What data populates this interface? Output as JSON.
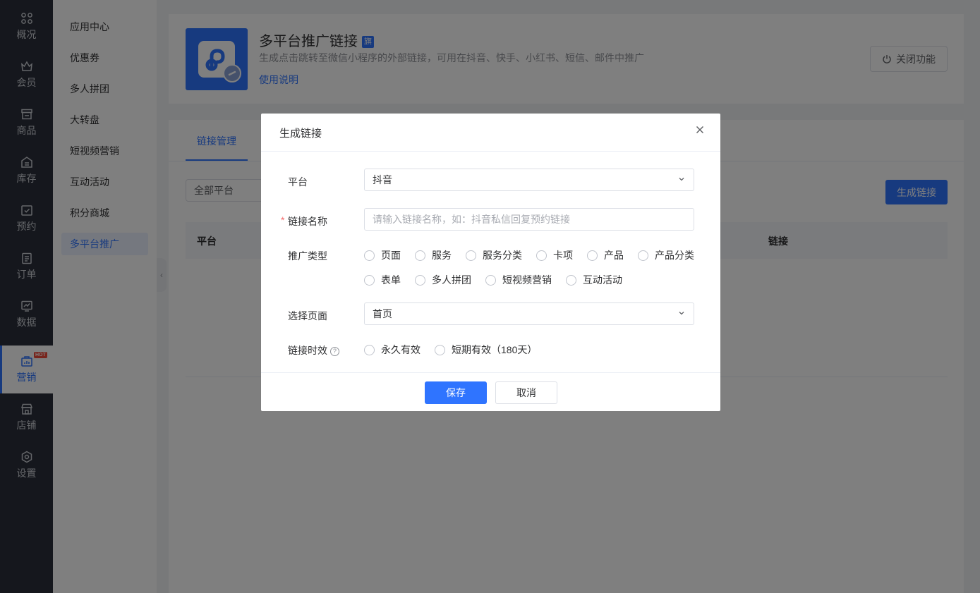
{
  "nav": {
    "items": [
      {
        "label": "概况",
        "icon": "grid-icon"
      },
      {
        "label": "会员",
        "icon": "crown-icon"
      },
      {
        "label": "商品",
        "icon": "shop-icon"
      },
      {
        "label": "库存",
        "icon": "warehouse-icon"
      },
      {
        "label": "预约",
        "icon": "calendar-check-icon"
      },
      {
        "label": "订单",
        "icon": "order-icon"
      },
      {
        "label": "数据",
        "icon": "chart-icon"
      },
      {
        "label": "营销",
        "icon": "marketing-icon",
        "badge": "HOT"
      },
      {
        "label": "店铺",
        "icon": "store-icon"
      },
      {
        "label": "设置",
        "icon": "settings-icon"
      }
    ]
  },
  "submenu": {
    "items": [
      "应用中心",
      "优惠券",
      "多人拼团",
      "大转盘",
      "短视频营销",
      "互动活动",
      "积分商城",
      "多平台推广"
    ]
  },
  "app": {
    "title": "多平台推广链接",
    "flag": "旗",
    "description": "生成点击跳转至微信小程序的外部链接，可用在抖音、快手、小红书、短信、邮件中推广",
    "help_link": "使用说明",
    "close_button": "关闭功能"
  },
  "tabs": {
    "active": "链接管理"
  },
  "filter": {
    "platform": "全部平台"
  },
  "toolbar": {
    "generate": "生成链接"
  },
  "table": {
    "headers": {
      "platform": "平台",
      "link": "链接"
    }
  },
  "dialog": {
    "title": "生成链接",
    "platform_label": "平台",
    "platform_value": "抖音",
    "name_label": "链接名称",
    "name_placeholder": "请输入链接名称，如：抖音私信回复预约链接",
    "type_label": "推广类型",
    "type_options": [
      "页面",
      "服务",
      "服务分类",
      "卡项",
      "产品",
      "产品分类",
      "表单",
      "多人拼团",
      "短视频营销",
      "互动活动"
    ],
    "page_label": "选择页面",
    "page_value": "首页",
    "validity_label": "链接时效",
    "validity_options": [
      "永久有效",
      "短期有效（180天）"
    ],
    "save": "保存",
    "cancel": "取消"
  },
  "colors": {
    "primary": "#2f74ff",
    "nav_bg": "#2b2f3a",
    "required": "#f56c6c",
    "hot": "#f04a3a"
  }
}
